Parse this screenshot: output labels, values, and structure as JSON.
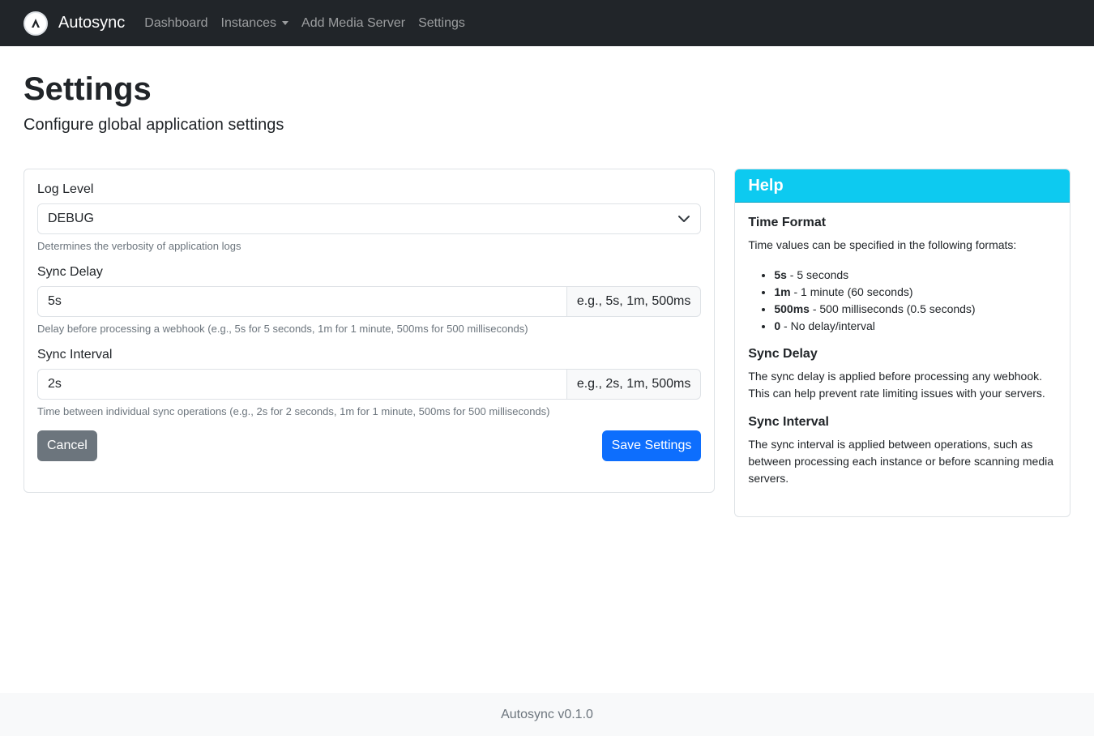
{
  "navbar": {
    "brand": "Autosync",
    "links": [
      "Dashboard",
      "Instances",
      "Add Media Server",
      "Settings"
    ]
  },
  "page": {
    "title": "Settings",
    "subtitle": "Configure global application settings"
  },
  "form": {
    "log_level": {
      "label": "Log Level",
      "value": "DEBUG",
      "help": "Determines the verbosity of application logs"
    },
    "sync_delay": {
      "label": "Sync Delay",
      "value": "5s",
      "addon": "e.g., 5s, 1m, 500ms",
      "help": "Delay before processing a webhook (e.g., 5s for 5 seconds, 1m for 1 minute, 500ms for 500 milliseconds)"
    },
    "sync_interval": {
      "label": "Sync Interval",
      "value": "2s",
      "addon": "e.g., 2s, 1m, 500ms",
      "help": "Time between individual sync operations (e.g., 2s for 2 seconds, 1m for 1 minute, 500ms for 500 milliseconds)"
    },
    "cancel_label": "Cancel",
    "save_label": "Save Settings"
  },
  "help": {
    "header": "Help",
    "time_format_title": "Time Format",
    "time_format_text": "Time values can be specified in the following formats:",
    "formats": [
      {
        "code": "5s",
        "desc": " - 5 seconds"
      },
      {
        "code": "1m",
        "desc": " - 1 minute (60 seconds)"
      },
      {
        "code": "500ms",
        "desc": " - 500 milliseconds (0.5 seconds)"
      },
      {
        "code": "0",
        "desc": " - No delay/interval"
      }
    ],
    "sync_delay_title": "Sync Delay",
    "sync_delay_text": "The sync delay is applied before processing any webhook. This can help prevent rate limiting issues with your servers.",
    "sync_interval_title": "Sync Interval",
    "sync_interval_text": "The sync interval is applied between operations, such as between processing each instance or before scanning media servers."
  },
  "footer": {
    "text": "Autosync v0.1.0"
  },
  "colors": {
    "navbar": "#212529",
    "primary": "#0d6efd",
    "secondary": "#6c757d",
    "info": "#0dcaf0"
  }
}
